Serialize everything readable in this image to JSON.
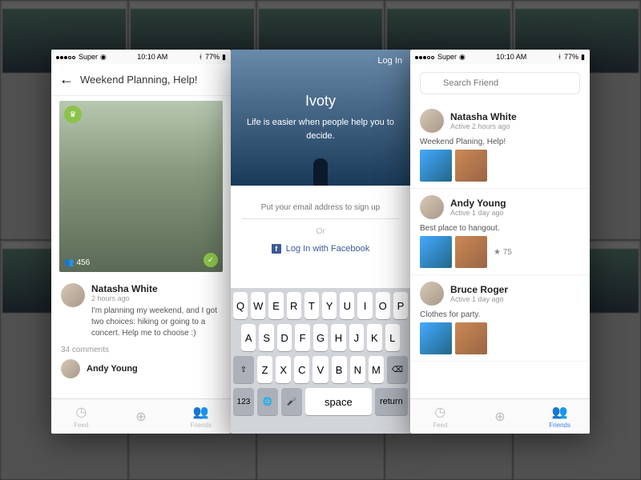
{
  "status": {
    "carrier": "Super",
    "time": "10:10 AM",
    "battery": "77%"
  },
  "screen_left": {
    "title": "Weekend Planning, Help!",
    "votes": "456",
    "author": {
      "name": "Natasha White",
      "meta": "2 hours ago"
    },
    "text": "I'm planning my weekend, and I got two choices: hiking or going to a concert. Help me to choose :)",
    "comments": "34 comments",
    "reply": {
      "name": "Andy Young"
    },
    "tabs": {
      "feed": "Feed",
      "add": "",
      "friends": "Friends"
    }
  },
  "screen_center": {
    "login": "Log In",
    "brand": "Ivoty",
    "tagline": "Life is easier when people help you to decide.",
    "email_placeholder": "Put your email address to sign up",
    "or": "Or",
    "fb": "Log In with Facebook",
    "keys_r1": [
      "Q",
      "W",
      "E",
      "R",
      "T",
      "Y",
      "U",
      "I",
      "O",
      "P"
    ],
    "keys_r2": [
      "A",
      "S",
      "D",
      "F",
      "G",
      "H",
      "J",
      "K",
      "L"
    ],
    "keys_r3": [
      "Z",
      "X",
      "C",
      "V",
      "B",
      "N",
      "M"
    ],
    "key_shift": "⇧",
    "key_del": "⌫",
    "key_123": "123",
    "key_globe": "🌐",
    "key_mic": "🎤",
    "key_space": "space",
    "key_return": "return"
  },
  "screen_right": {
    "search_placeholder": "Search Friend",
    "friends": [
      {
        "name": "Natasha White",
        "meta": "Active 2 hours ago",
        "sub": "Weekend Planing, Help!"
      },
      {
        "name": "Andy Young",
        "meta": "Active 1 day ago",
        "sub": "Best place to hangout.",
        "count": "75"
      },
      {
        "name": "Bruce Roger",
        "meta": "Active 1 day ago",
        "sub": "Clothes for party."
      }
    ],
    "tabs": {
      "feed": "Feed",
      "friends": "Friends"
    }
  }
}
